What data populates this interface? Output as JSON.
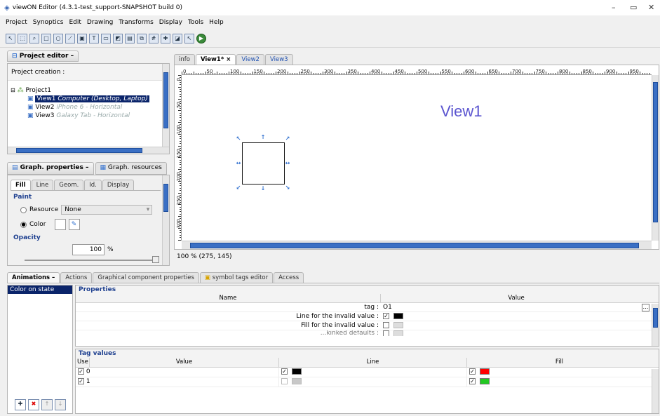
{
  "window": {
    "title": "viewON Editor (4.3.1-test_support-SNAPSHOT build 0)",
    "min": "–",
    "max": "▭",
    "close": "✕"
  },
  "menu": [
    "Project",
    "Synoptics",
    "Edit",
    "Drawing",
    "Transforms",
    "Display",
    "Tools",
    "Help"
  ],
  "project_editor": {
    "title": "Project editor",
    "section": "Project creation :",
    "project": "Project1",
    "views": [
      {
        "name": "View1",
        "device": "Computer (Desktop, Laptop)"
      },
      {
        "name": "View2",
        "device": "iPhone 6 - Horizontal"
      },
      {
        "name": "View3",
        "device": "Galaxy Tab - Horizontal"
      }
    ]
  },
  "graph_properties": {
    "tab1": "Graph. properties",
    "tab2": "Graph. resources",
    "subtabs": [
      "Fill",
      "Line",
      "Geom.",
      "Id.",
      "Display"
    ],
    "paint_label": "Paint",
    "resource_label": "Resource",
    "resource_value": "None",
    "color_label": "Color",
    "opacity_label": "Opacity",
    "opacity_value": "100",
    "opacity_unit": "%"
  },
  "editor": {
    "tabs": [
      "info",
      "View1*",
      "View2",
      "View3"
    ],
    "close_glyph": "×",
    "canvas_label": "View1",
    "status": "100 % (275, 145)",
    "ruler_h": [
      "0",
      "50",
      "100",
      "150",
      "200",
      "250",
      "300",
      "350",
      "400",
      "450",
      "500",
      "550",
      "600",
      "650",
      "700",
      "750",
      "800",
      "850",
      "900",
      "950"
    ],
    "ruler_v": [
      "0",
      "50",
      "100",
      "150",
      "200",
      "250",
      "300"
    ]
  },
  "bottom": {
    "tabs": [
      "Animations",
      "Actions",
      "Graphical component properties",
      "symbol tags editor",
      "Access"
    ],
    "list_items": [
      "Color on state"
    ],
    "properties_label": "Properties",
    "col_name": "Name",
    "col_value": "Value",
    "rows": [
      {
        "name": "tag :",
        "value": "O1"
      },
      {
        "name": "Line for the invalid value :"
      },
      {
        "name": "Fill for the invalid value :"
      },
      {
        "name": "...kinked defaults :"
      }
    ],
    "tag_values_label": "Tag values",
    "tv_cols": [
      "Use",
      "Value",
      "Line",
      "Fill"
    ],
    "tv_rows": [
      {
        "value": "0",
        "line_color": "#000000",
        "fill_color": "#ff0000"
      },
      {
        "value": "1",
        "line_color": "#c8c8c8",
        "fill_color": "#22c822"
      }
    ]
  }
}
